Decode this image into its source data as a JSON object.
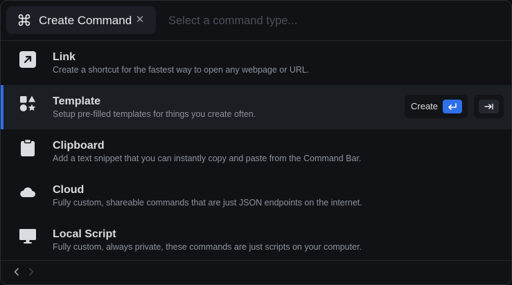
{
  "header": {
    "tag_label": "Create Command",
    "tag_icon": "command-icon",
    "search_placeholder": "Select a command type..."
  },
  "items": [
    {
      "title": "Link",
      "description": "Create a shortcut for the fastest way to open any webpage or URL.",
      "icon": "arrow-up-right-icon"
    },
    {
      "title": "Template",
      "description": "Setup pre-filled templates for things you create often.",
      "icon": "shapes-icon",
      "selected": true
    },
    {
      "title": "Clipboard",
      "description": "Add a text snippet that you can instantly copy and paste from the Command Bar.",
      "icon": "clipboard-icon"
    },
    {
      "title": "Cloud",
      "description": "Fully custom, shareable commands that are just JSON endpoints on the internet.",
      "icon": "cloud-icon"
    },
    {
      "title": "Local Script",
      "description": "Fully custom, always private, these commands are just scripts on your computer.",
      "icon": "monitor-icon"
    }
  ],
  "actions": {
    "create_label": "Create"
  },
  "colors": {
    "accent": "#2f6fe9",
    "background": "#101216",
    "selected_row": "#1b1e23"
  }
}
